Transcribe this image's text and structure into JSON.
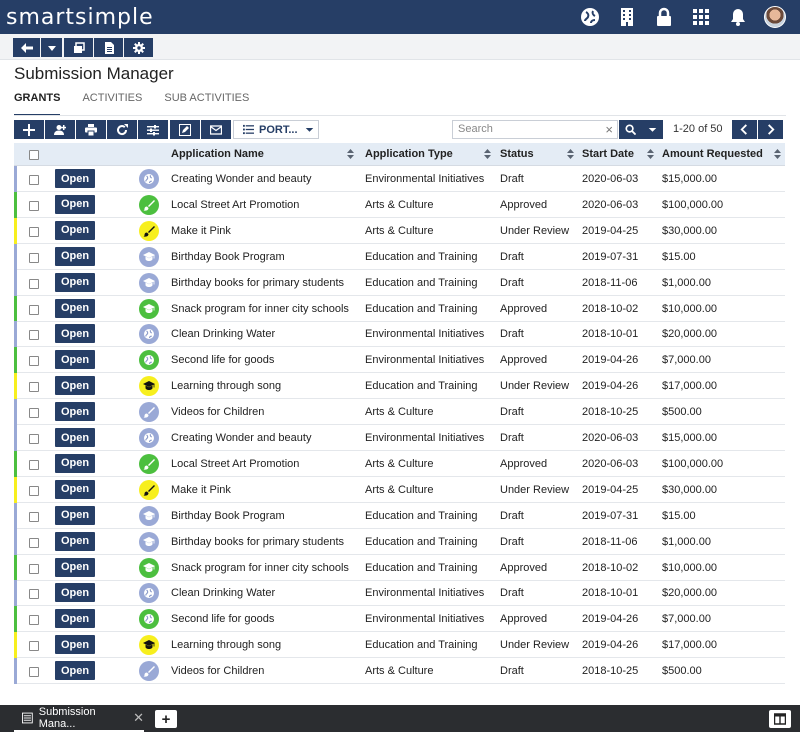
{
  "app": {
    "logo": "smartsimple"
  },
  "top_icons": [
    "globe-icon",
    "building-icon",
    "lock-icon",
    "apps-grid-icon",
    "bell-icon",
    "user-avatar"
  ],
  "page": {
    "title": "Submission Manager"
  },
  "tabs": [
    {
      "label": "GRANTS",
      "active": true
    },
    {
      "label": "ACTIVITIES",
      "active": false
    },
    {
      "label": "SUB ACTIVITIES",
      "active": false
    }
  ],
  "toolbar": {
    "view_button": "PORT...",
    "search_placeholder": "Search",
    "pager_text": "1-20 of 50"
  },
  "columns": {
    "name": "Application Name",
    "type": "Application Type",
    "status": "Status",
    "start": "Start Date",
    "amount": "Amount Requested"
  },
  "open_label": "Open",
  "colors": {
    "brand": "#263e66",
    "draft": "#9aa9d6",
    "approved": "#4cbf3f",
    "review": "#f7ef1e"
  },
  "rows": [
    {
      "name": "Creating Wonder and beauty",
      "type": "Environmental Initiatives",
      "status": "Draft",
      "start": "2020-06-03",
      "amount": "$15,000.00",
      "icon": "globe-icon"
    },
    {
      "name": "Local Street Art Promotion",
      "type": "Arts & Culture",
      "status": "Approved",
      "start": "2020-06-03",
      "amount": "$100,000.00",
      "icon": "brush-icon"
    },
    {
      "name": "Make it Pink",
      "type": "Arts & Culture",
      "status": "Under Review",
      "start": "2019-04-25",
      "amount": "$30,000.00",
      "icon": "brush-icon"
    },
    {
      "name": "Birthday Book Program",
      "type": "Education and Training",
      "status": "Draft",
      "start": "2019-07-31",
      "amount": "$15.00",
      "icon": "graduation-cap-icon"
    },
    {
      "name": "Birthday books for primary students",
      "type": "Education and Training",
      "status": "Draft",
      "start": "2018-11-06",
      "amount": "$1,000.00",
      "icon": "graduation-cap-icon"
    },
    {
      "name": "Snack program for inner city schools",
      "type": "Education and Training",
      "status": "Approved",
      "start": "2018-10-02",
      "amount": "$10,000.00",
      "icon": "graduation-cap-icon"
    },
    {
      "name": "Clean Drinking Water",
      "type": "Environmental Initiatives",
      "status": "Draft",
      "start": "2018-10-01",
      "amount": "$20,000.00",
      "icon": "globe-icon"
    },
    {
      "name": "Second life for goods",
      "type": "Environmental Initiatives",
      "status": "Approved",
      "start": "2019-04-26",
      "amount": "$7,000.00",
      "icon": "globe-icon"
    },
    {
      "name": "Learning through song",
      "type": "Education and Training",
      "status": "Under Review",
      "start": "2019-04-26",
      "amount": "$17,000.00",
      "icon": "graduation-cap-icon"
    },
    {
      "name": "Videos for Children",
      "type": "Arts & Culture",
      "status": "Draft",
      "start": "2018-10-25",
      "amount": "$500.00",
      "icon": "brush-icon"
    },
    {
      "name": "Creating Wonder and beauty",
      "type": "Environmental Initiatives",
      "status": "Draft",
      "start": "2020-06-03",
      "amount": "$15,000.00",
      "icon": "globe-icon"
    },
    {
      "name": "Local Street Art Promotion",
      "type": "Arts & Culture",
      "status": "Approved",
      "start": "2020-06-03",
      "amount": "$100,000.00",
      "icon": "brush-icon"
    },
    {
      "name": "Make it Pink",
      "type": "Arts & Culture",
      "status": "Under Review",
      "start": "2019-04-25",
      "amount": "$30,000.00",
      "icon": "brush-icon"
    },
    {
      "name": "Birthday Book Program",
      "type": "Education and Training",
      "status": "Draft",
      "start": "2019-07-31",
      "amount": "$15.00",
      "icon": "graduation-cap-icon"
    },
    {
      "name": "Birthday books for primary students",
      "type": "Education and Training",
      "status": "Draft",
      "start": "2018-11-06",
      "amount": "$1,000.00",
      "icon": "graduation-cap-icon"
    },
    {
      "name": "Snack program for inner city schools",
      "type": "Education and Training",
      "status": "Approved",
      "start": "2018-10-02",
      "amount": "$10,000.00",
      "icon": "graduation-cap-icon"
    },
    {
      "name": "Clean Drinking Water",
      "type": "Environmental Initiatives",
      "status": "Draft",
      "start": "2018-10-01",
      "amount": "$20,000.00",
      "icon": "globe-icon"
    },
    {
      "name": "Second life for goods",
      "type": "Environmental Initiatives",
      "status": "Approved",
      "start": "2019-04-26",
      "amount": "$7,000.00",
      "icon": "globe-icon"
    },
    {
      "name": "Learning through song",
      "type": "Education and Training",
      "status": "Under Review",
      "start": "2019-04-26",
      "amount": "$17,000.00",
      "icon": "graduation-cap-icon"
    },
    {
      "name": "Videos for Children",
      "type": "Arts & Culture",
      "status": "Draft",
      "start": "2018-10-25",
      "amount": "$500.00",
      "icon": "brush-icon"
    }
  ],
  "bottom": {
    "tab_label": "Submission Mana..."
  }
}
